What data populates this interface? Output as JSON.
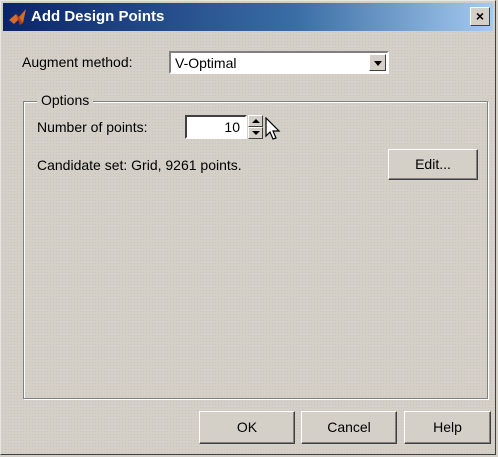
{
  "window": {
    "title": "Add Design Points",
    "close_glyph": "×"
  },
  "augment": {
    "label": "Augment method:",
    "value": "V-Optimal"
  },
  "options": {
    "title": "Options",
    "num_points_label": "Number of points:",
    "num_points_value": "10",
    "candidate_text": "Candidate set: Grid, 9261 points.",
    "edit_label": "Edit..."
  },
  "buttons": {
    "ok": "OK",
    "cancel": "Cancel",
    "help": "Help"
  },
  "icons": {
    "title_icon": "matlab-logo-icon",
    "dropdown": "chevron-down-icon",
    "spin_up": "spin-up-icon",
    "spin_down": "spin-down-icon",
    "cursor": "mouse-pointer-icon"
  },
  "colors": {
    "titlebar_start": "#0a246a",
    "titlebar_end": "#a6caf0",
    "face": "#d4d0c8"
  }
}
